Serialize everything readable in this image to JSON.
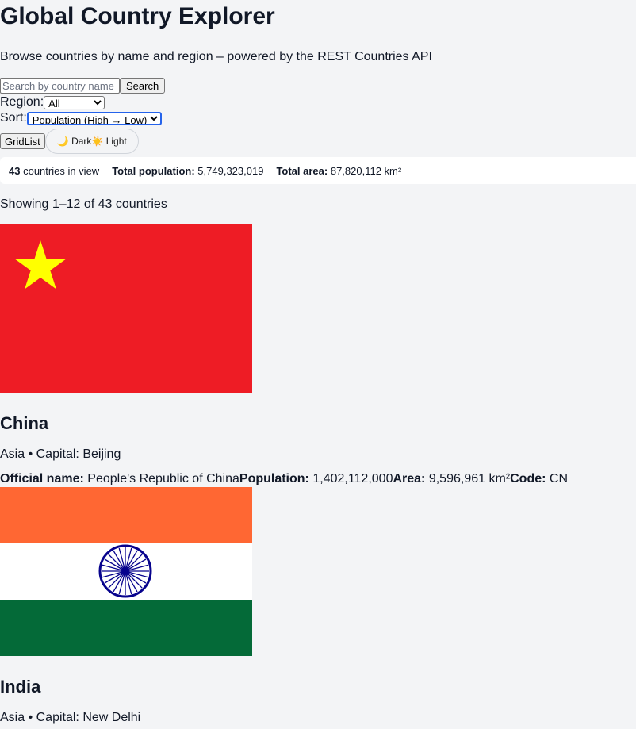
{
  "header": {
    "title": "Global Country Explorer",
    "subtitle": "Browse countries by name and region – powered by the REST Countries API"
  },
  "search": {
    "placeholder": "Search by country name",
    "button_label": "Search"
  },
  "filters": {
    "region_label": "Region:",
    "region_value": "All",
    "sort_label": "Sort:",
    "sort_value": "Population (High → Low)"
  },
  "view": {
    "grid_label": "Grid",
    "list_label": "List",
    "dark_label": "🌙 Dark",
    "light_label": "☀️ Light"
  },
  "stats": {
    "count": "43",
    "count_suffix": "countries in view",
    "population_label": "Total population:",
    "population_value": "5,749,323,019",
    "area_label": "Total area:",
    "area_value": "87,820,112 km²"
  },
  "showing": "Showing 1–12 of 43 countries",
  "countries": [
    {
      "name": "China",
      "meta": "Asia • Capital: Beijing",
      "official_label": "Official name:",
      "official_value": "People's Republic of China",
      "population_label": "Population:",
      "population_value": "1,402,112,000",
      "area_label": "Area:",
      "area_value": "9,596,961 km²",
      "code_label": "Code:",
      "code_value": "CN",
      "flag": "china-flag",
      "flag_colors": {
        "red": "#ee1c25",
        "star": "#ffff00"
      }
    },
    {
      "name": "India",
      "meta": "Asia • Capital: New Delhi",
      "flag": "india-flag",
      "flag_colors": {
        "saffron": "#ff6733",
        "white": "#ffffff",
        "green": "#046a38",
        "chakra": "#07038d"
      }
    }
  ]
}
